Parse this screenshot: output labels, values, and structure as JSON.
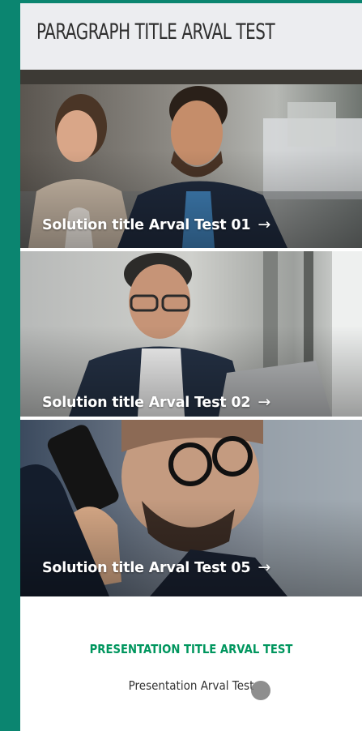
{
  "header": {
    "title": "PARAGRAPH TITLE ARVAL TEST"
  },
  "solutions": [
    {
      "label": "Solution title Arval Test 01",
      "arrow": "→",
      "image": "couple-smiling-photo"
    },
    {
      "label": "Solution title Arval Test 02",
      "arrow": "→",
      "image": "businessman-laptop-photo"
    },
    {
      "label": "Solution title Arval Test 05",
      "arrow": "→",
      "image": "man-on-phone-photo"
    }
  ],
  "presentation": {
    "title": "PRESENTATION TITLE ARVAL TEST",
    "text": "Presentation Arval Test"
  },
  "colors": {
    "frame": "#0b8570",
    "accent": "#00965e",
    "header_bg": "#ecedf0"
  }
}
